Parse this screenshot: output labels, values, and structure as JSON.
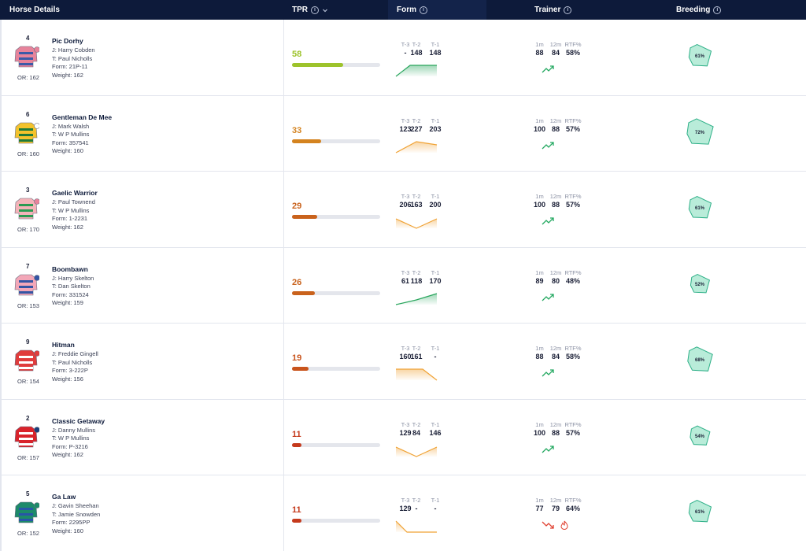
{
  "header": {
    "horse_details": "Horse Details",
    "tpr": "TPR",
    "form": "Form",
    "trainer": "Trainer",
    "breeding": "Breeding"
  },
  "form_labels": [
    "T-3",
    "T-2",
    "T-1"
  ],
  "trainer_labels": [
    "1m",
    "12m",
    "RTF%"
  ],
  "colors": {
    "header_bg": "#0d1a3a",
    "tpr_high": "#9dc32b",
    "tpr_mid": "#d4831f",
    "tpr_low": "#c9541c",
    "tpr_lowest": "#c53a1c",
    "trend_up": "#23a860",
    "trend_down": "#e04030",
    "breeding_fill": "#b9ecd9",
    "breeding_stroke": "#2fb088"
  },
  "runners": [
    {
      "number": "4",
      "name": "Pic Dorhy",
      "jockey": "J: Harry Cobden",
      "trainer": "T: Paul Nicholls",
      "form": "Form: 21P-11",
      "weight": "Weight: 162",
      "or": "OR: 162",
      "tpr": "58",
      "tpr_pct": 0.58,
      "tpr_color": "#9dc32b",
      "form_values": [
        "-",
        "148",
        "148"
      ],
      "form_trend": "up",
      "form_color": "#2aa65e",
      "trainer_values": [
        "88",
        "84",
        "58%"
      ],
      "trend": "up",
      "hot": false,
      "breeding": "61%",
      "breeding_pct": 0.61,
      "silks": {
        "body": "#e7839b",
        "stripe": "#3b5aa8",
        "cap": "#e7839b"
      }
    },
    {
      "number": "6",
      "name": "Gentleman De Mee",
      "jockey": "J: Mark Walsh",
      "trainer": "T: W P Mullins",
      "form": "Form: 357541",
      "weight": "Weight: 160",
      "or": "OR: 160",
      "tpr": "33",
      "tpr_pct": 0.33,
      "tpr_color": "#d4831f",
      "form_values": [
        "123",
        "227",
        "203"
      ],
      "form_trend": "peak",
      "form_color": "#f0a234",
      "trainer_values": [
        "100",
        "88",
        "57%"
      ],
      "trend": "up",
      "hot": false,
      "breeding": "72%",
      "breeding_pct": 0.72,
      "silks": {
        "body": "#f3c22c",
        "stripe": "#1f7a3a",
        "cap": "#ffffff"
      }
    },
    {
      "number": "3",
      "name": "Gaelic Warrior",
      "jockey": "J: Paul Townend",
      "trainer": "T: W P Mullins",
      "form": "Form: 1-2231",
      "weight": "Weight: 162",
      "or": "OR: 170",
      "tpr": "29",
      "tpr_pct": 0.29,
      "tpr_color": "#c9621c",
      "form_values": [
        "206",
        "163",
        "200"
      ],
      "form_trend": "valley",
      "form_color": "#f0a234",
      "trainer_values": [
        "100",
        "88",
        "57%"
      ],
      "trend": "up",
      "hot": false,
      "breeding": "61%",
      "breeding_pct": 0.61,
      "silks": {
        "body": "#f4b3b8",
        "stripe": "#2b9a52",
        "cap": "#e7839b"
      }
    },
    {
      "number": "7",
      "name": "Boombawn",
      "jockey": "J: Harry Skelton",
      "trainer": "T: Dan Skelton",
      "form": "Form: 331524",
      "weight": "Weight: 159",
      "or": "OR: 153",
      "tpr": "26",
      "tpr_pct": 0.26,
      "tpr_color": "#c9621c",
      "form_values": [
        "61",
        "118",
        "170"
      ],
      "form_trend": "rise",
      "form_color": "#2aa65e",
      "trainer_values": [
        "89",
        "80",
        "48%"
      ],
      "trend": "up",
      "hot": false,
      "breeding": "52%",
      "breeding_pct": 0.52,
      "silks": {
        "body": "#f3a7b8",
        "stripe": "#3455a4",
        "cap": "#3455a4"
      }
    },
    {
      "number": "9",
      "name": "Hitman",
      "jockey": "J: Freddie Gingell",
      "trainer": "T: Paul Nicholls",
      "form": "Form: 3-222P",
      "weight": "Weight: 156",
      "or": "OR: 154",
      "tpr": "19",
      "tpr_pct": 0.19,
      "tpr_color": "#c9541c",
      "form_values": [
        "160",
        "161",
        "-"
      ],
      "form_trend": "fall",
      "form_color": "#f0a234",
      "trainer_values": [
        "88",
        "84",
        "58%"
      ],
      "trend": "up",
      "hot": false,
      "breeding": "68%",
      "breeding_pct": 0.68,
      "silks": {
        "body": "#e03c3c",
        "stripe": "#ffffff",
        "cap": "#e03c3c"
      }
    },
    {
      "number": "2",
      "name": "Classic Getaway",
      "jockey": "J: Danny Mullins",
      "trainer": "T: W P Mullins",
      "form": "Form: P-3216",
      "weight": "Weight: 162",
      "or": "OR: 157",
      "tpr": "11",
      "tpr_pct": 0.11,
      "tpr_color": "#c53a1c",
      "form_values": [
        "129",
        "84",
        "146"
      ],
      "form_trend": "valley",
      "form_color": "#f0a234",
      "trainer_values": [
        "100",
        "88",
        "57%"
      ],
      "trend": "up",
      "hot": false,
      "breeding": "54%",
      "breeding_pct": 0.54,
      "silks": {
        "body": "#d9232b",
        "stripe": "#ffffff",
        "cap": "#1b3f7a"
      }
    },
    {
      "number": "5",
      "name": "Ga Law",
      "jockey": "J: Gavin Sheehan",
      "trainer": "T: Jamie Snowden",
      "form": "Form: 2295PP",
      "weight": "Weight: 160",
      "or": "OR: 152",
      "tpr": "11",
      "tpr_pct": 0.11,
      "tpr_color": "#c53a1c",
      "form_values": [
        "129",
        "-",
        "-"
      ],
      "form_trend": "drop",
      "form_color": "#f0a234",
      "trainer_values": [
        "77",
        "79",
        "64%"
      ],
      "trend": "down",
      "hot": true,
      "breeding": "61%",
      "breeding_pct": 0.61,
      "silks": {
        "body": "#1d8a6a",
        "stripe": "#2856a8",
        "cap": "#1d8a6a"
      }
    }
  ]
}
